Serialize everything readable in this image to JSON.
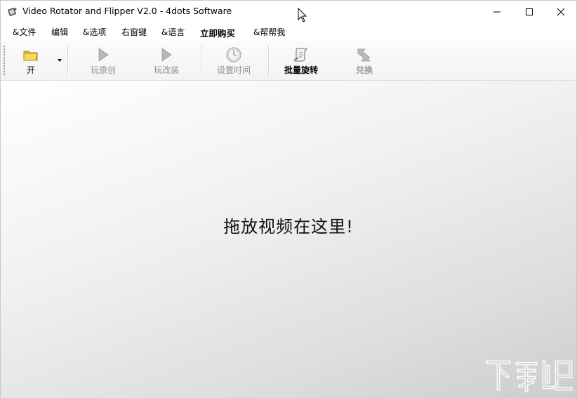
{
  "window": {
    "title": "Video Rotator and Flipper V2.0 - 4dots Software"
  },
  "menu": {
    "items": [
      {
        "label": "&文件"
      },
      {
        "label": "编辑"
      },
      {
        "label": "&选项"
      },
      {
        "label": "右窗键"
      },
      {
        "label": "&语言"
      },
      {
        "label": "立即购买"
      },
      {
        "label": "&帮帮我"
      }
    ]
  },
  "toolbar": {
    "open_label": "开",
    "play_original_label": "玩原创",
    "play_modified_label": "玩改装",
    "set_time_label": "设置时间",
    "batch_rotate_label": "批量旋转",
    "convert_label": "兑换"
  },
  "drop_area": {
    "message": "拖放视频在这里!"
  },
  "watermark": {
    "text": "下载吧"
  },
  "colors": {
    "toolbar_bg": "#f6f6f6",
    "drop_area_start": "#ffffff",
    "drop_area_end": "#cdcdcd",
    "disabled_text": "#8e8e8e"
  }
}
